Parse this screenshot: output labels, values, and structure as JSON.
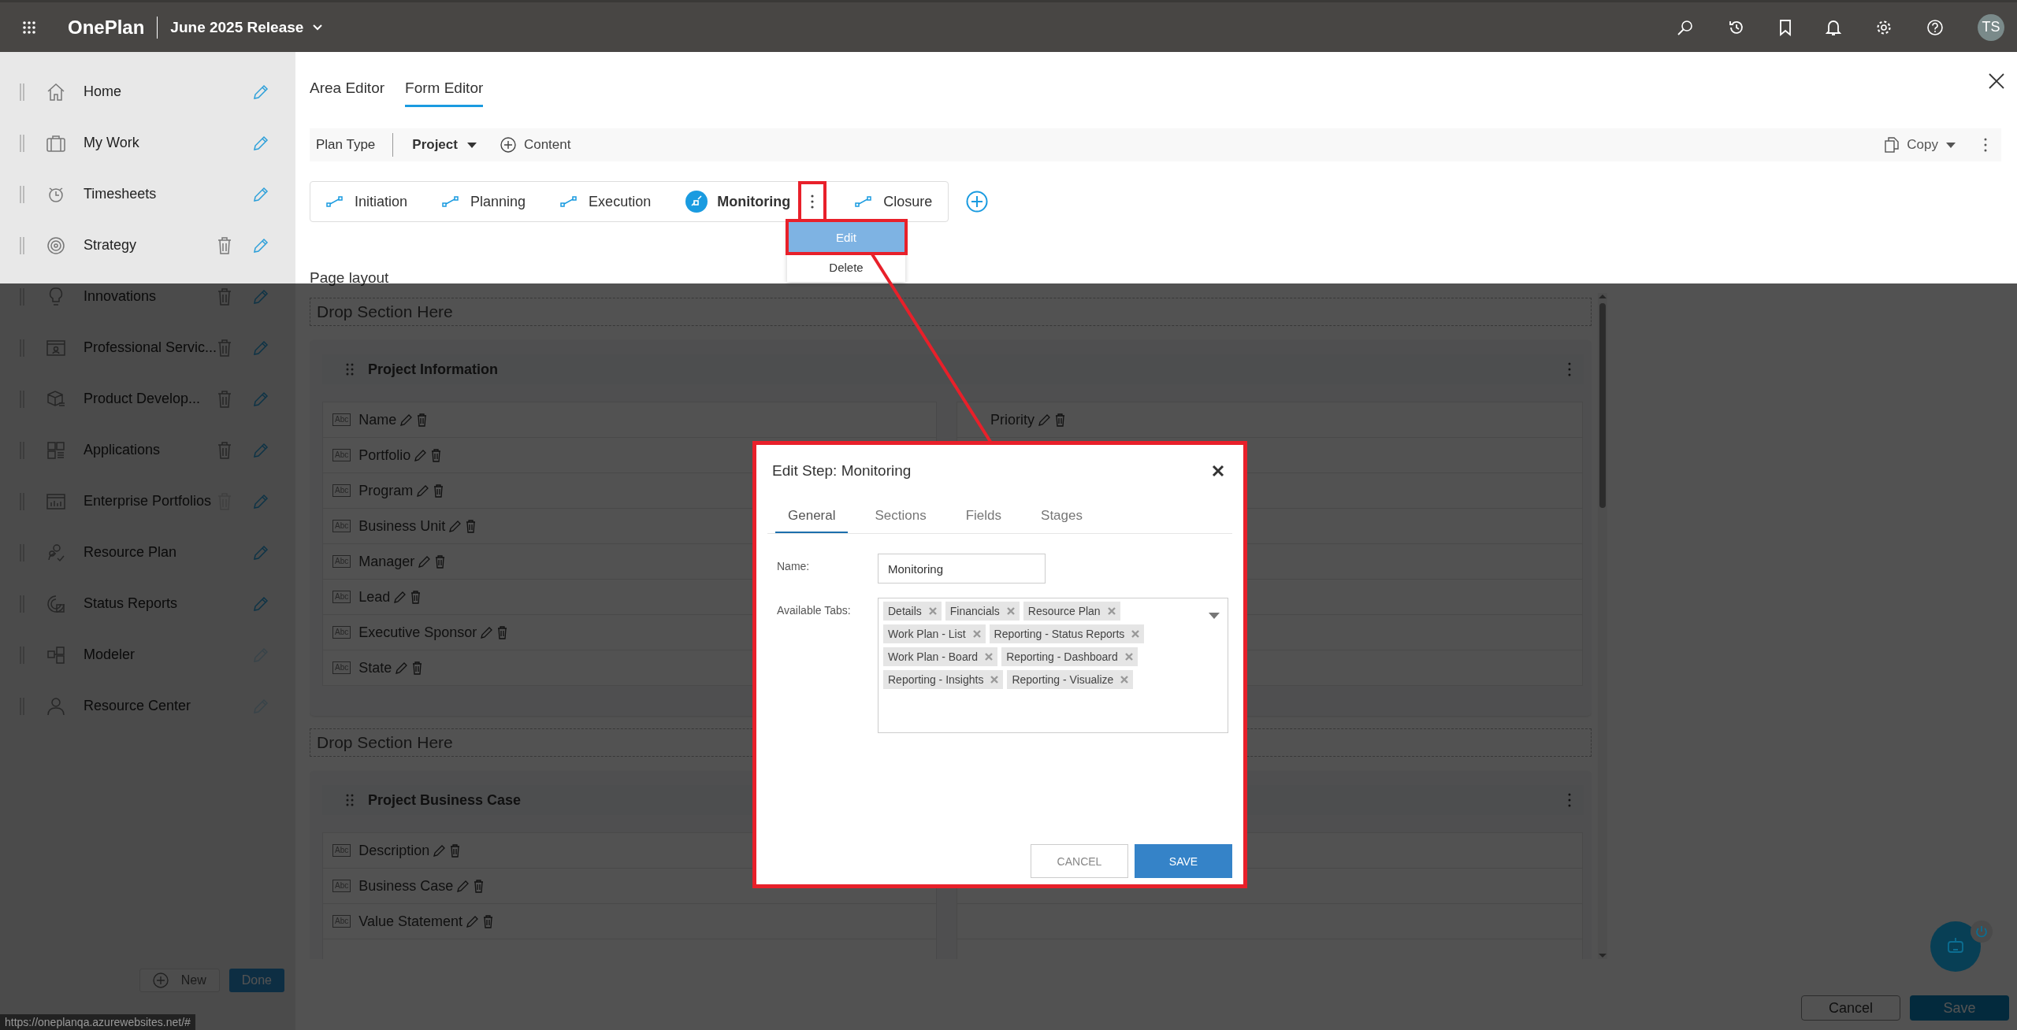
{
  "top_bar": {
    "app_name": "OnePlan",
    "release": "June 2025 Release",
    "avatar": "TS"
  },
  "sidebar": {
    "items": [
      {
        "label": "Home",
        "deletable": false,
        "edit_disabled": false
      },
      {
        "label": "My Work",
        "deletable": false,
        "edit_disabled": false
      },
      {
        "label": "Timesheets",
        "deletable": false,
        "edit_disabled": false
      },
      {
        "label": "Strategy",
        "deletable": true,
        "delete_disabled": false,
        "edit_disabled": false
      },
      {
        "label": "Innovations",
        "deletable": true,
        "delete_disabled": false,
        "edit_disabled": false
      },
      {
        "label": "Professional Servic...",
        "deletable": true,
        "delete_disabled": false,
        "edit_disabled": false
      },
      {
        "label": "Product Develop...",
        "deletable": true,
        "delete_disabled": false,
        "edit_disabled": false
      },
      {
        "label": "Applications",
        "deletable": true,
        "delete_disabled": false,
        "edit_disabled": false
      },
      {
        "label": "Enterprise Portfolios",
        "deletable": true,
        "delete_disabled": true,
        "edit_disabled": false
      },
      {
        "label": "Resource Plan",
        "deletable": false,
        "edit_disabled": false
      },
      {
        "label": "Status Reports",
        "deletable": false,
        "edit_disabled": false
      },
      {
        "label": "Modeler",
        "deletable": false,
        "edit_disabled": true
      },
      {
        "label": "Resource Center",
        "deletable": false,
        "edit_disabled": true
      }
    ],
    "new_button": "New",
    "done_button": "Done"
  },
  "status_url": "https://oneplanqa.azurewebsites.net/#",
  "editor_tabs": [
    {
      "label": "Area Editor",
      "selected": false
    },
    {
      "label": "Form Editor",
      "selected": true
    }
  ],
  "toolbar": {
    "plan_type_label": "Plan Type",
    "plan_type": "Project",
    "content_button": "Content",
    "copy_button": "Copy"
  },
  "steps": [
    {
      "label": "Initiation",
      "selected": false
    },
    {
      "label": "Planning",
      "selected": false
    },
    {
      "label": "Execution",
      "selected": false
    },
    {
      "label": "Monitoring",
      "selected": true
    },
    {
      "label": "Closure",
      "selected": false
    }
  ],
  "step_menu": [
    {
      "label": "Edit",
      "selected": true
    },
    {
      "label": "Delete",
      "selected": false
    }
  ],
  "page_layout": {
    "title": "Page layout",
    "blocks": [
      {
        "kind": "drop",
        "label": "Drop Section Here"
      },
      {
        "kind": "section",
        "title": "Project Information",
        "left": [
          {
            "type": "Abc",
            "name": "Name"
          },
          {
            "type": "Abc",
            "name": "Portfolio"
          },
          {
            "type": "Abc",
            "name": "Program"
          },
          {
            "type": "Abc",
            "name": "Business Unit"
          },
          {
            "type": "Abc",
            "name": "Manager"
          },
          {
            "type": "Abc",
            "name": "Lead"
          },
          {
            "type": "Abc",
            "name": "Executive Sponsor"
          },
          {
            "type": "Abc",
            "name": "State"
          }
        ],
        "right": [
          {
            "name": "Priority"
          }
        ]
      },
      {
        "kind": "drop",
        "label": "Drop Section Here"
      },
      {
        "kind": "section",
        "title": "Project Business Case",
        "left": [
          {
            "type": "Abc",
            "name": "Description"
          },
          {
            "type": "Abc",
            "name": "Business Case"
          },
          {
            "type": "Abc",
            "name": "Value Statement"
          }
        ]
      }
    ]
  },
  "footer": {
    "cancel": "Cancel",
    "save": "Save"
  },
  "dialog": {
    "title": "Edit Step: Monitoring",
    "tabs": [
      {
        "label": "General",
        "selected": true
      },
      {
        "label": "Sections",
        "selected": false
      },
      {
        "label": "Fields",
        "selected": false
      },
      {
        "label": "Stages",
        "selected": false
      }
    ],
    "name_label": "Name:",
    "name_value": "Monitoring",
    "tabs_label": "Available Tabs:",
    "chips": [
      "Details",
      "Financials",
      "Resource Plan",
      "Work Plan - List",
      "Reporting - Status Reports",
      "Work Plan - Board",
      "Reporting - Dashboard",
      "Reporting - Insights",
      "Reporting - Visualize"
    ],
    "cancel": "CANCEL",
    "save": "SAVE"
  }
}
